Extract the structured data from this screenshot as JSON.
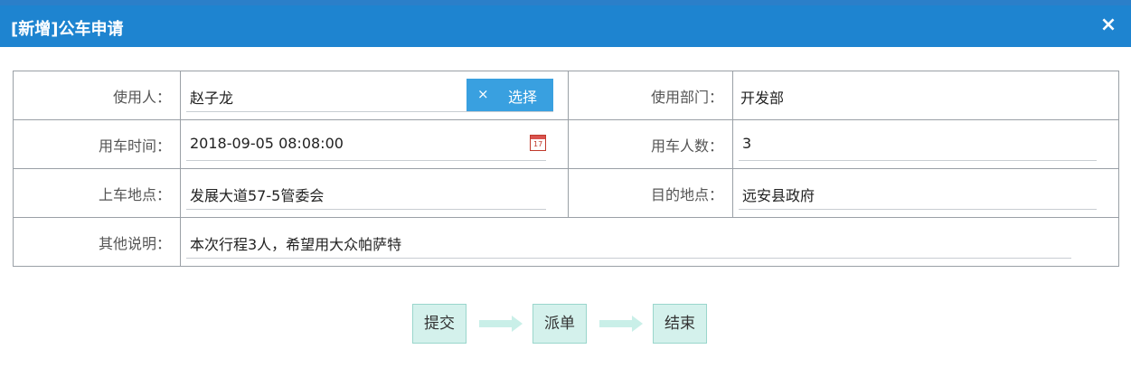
{
  "dialog": {
    "title": "[新增]公车申请",
    "close_symbol": "×"
  },
  "form": {
    "user_label": "使用人：",
    "user_value": "赵子龙",
    "clear_symbol": "×",
    "select_label": "选择",
    "dept_label": "使用部门：",
    "dept_value": "开发部",
    "time_label": "用车时间：",
    "time_value": "2018-09-05 08:08:00",
    "count_label": "用车人数：",
    "count_value": "3",
    "pickup_label": "上车地点：",
    "pickup_value": "发展大道57-5管委会",
    "dest_label": "目的地点：",
    "dest_value": "远安县政府",
    "note_label": "其他说明：",
    "note_value": "本次行程3人，希望用大众帕萨特"
  },
  "workflow": {
    "steps": [
      "提交",
      "派单",
      "结束"
    ],
    "step_color": "#d4f1ec",
    "arrow_color": "#c9efe8"
  },
  "colors": {
    "titlebar": "#1e84d0",
    "select_button": "#39a0e0"
  },
  "icons": {
    "calendar": "calendar-icon",
    "close": "close-icon"
  }
}
